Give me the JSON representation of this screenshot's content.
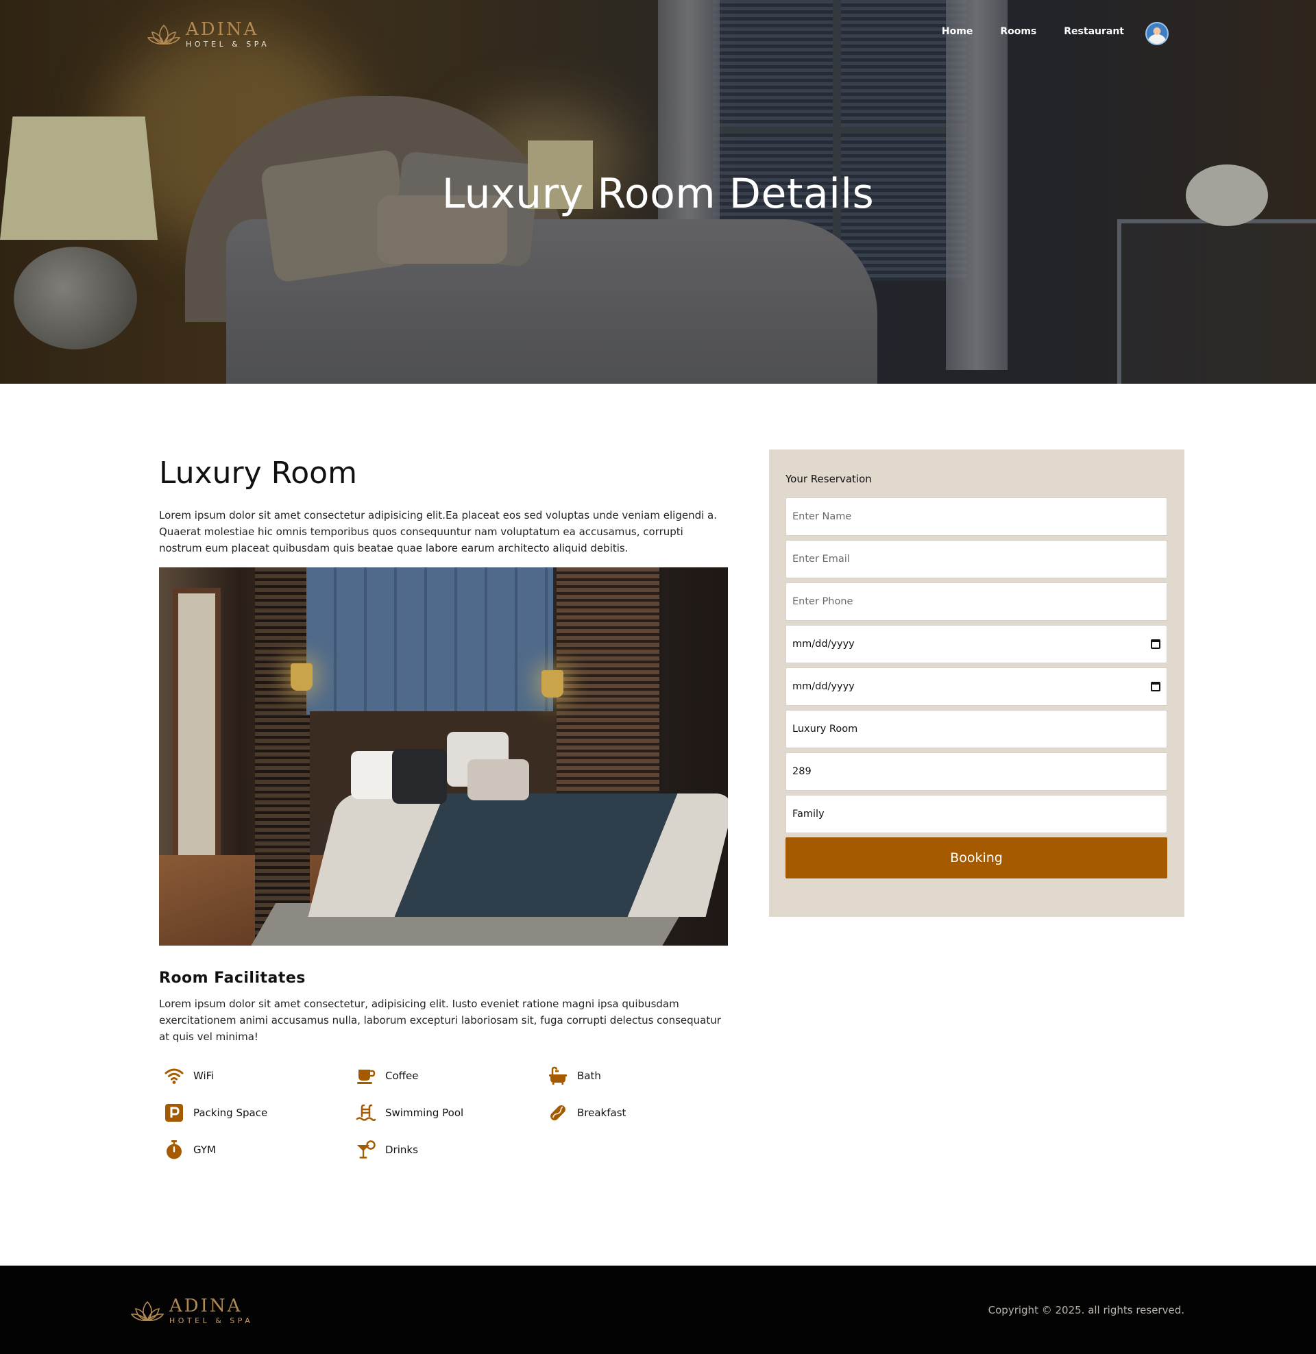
{
  "brand": {
    "name": "ADINA",
    "tagline": "HOTEL & SPA",
    "color": "#b38a52"
  },
  "nav": {
    "items": [
      {
        "label": "Home"
      },
      {
        "label": "Rooms"
      },
      {
        "label": "Restaurant"
      }
    ],
    "avatar_icon": "user-avatar"
  },
  "hero": {
    "title": "Luxury Room Details"
  },
  "room": {
    "title": "Luxury Room",
    "description": "Lorem ipsum dolor sit amet consectetur adipisicing elit.Ea placeat eos sed voluptas unde veniam eligendi a. Quaerat molestiae hic omnis temporibus quos consequuntur nam voluptatum ea accusamus, corrupti nostrum eum placeat quibusdam quis beatae quae labore earum architecto aliquid debitis."
  },
  "facilities": {
    "title": "Room Facilitates",
    "description": "Lorem ipsum dolor sit amet consectetur, adipisicing elit. Iusto eveniet ratione magni ipsa quibusdam exercitationem animi accusamus nulla, laborum excepturi laboriosam sit, fuga corrupti delectus consequatur at quis vel minima!",
    "icon_color": "#a55a00",
    "items": [
      {
        "label": "WiFi",
        "icon": "wifi-icon"
      },
      {
        "label": "Coffee",
        "icon": "coffee-icon"
      },
      {
        "label": "Bath",
        "icon": "bath-icon"
      },
      {
        "label": "Packing Space",
        "icon": "parking-icon"
      },
      {
        "label": "Swimming Pool",
        "icon": "swimming-pool-icon"
      },
      {
        "label": "Breakfast",
        "icon": "breakfast-icon"
      },
      {
        "label": "GYM",
        "icon": "stopwatch-icon"
      },
      {
        "label": "Drinks",
        "icon": "cocktail-icon"
      }
    ]
  },
  "reservation": {
    "title": "Your Reservation",
    "name_placeholder": "Enter Name",
    "email_placeholder": "Enter Email",
    "phone_placeholder": "Enter Phone",
    "checkin_value": "mm/dd/yyyy",
    "checkout_value": "mm/dd/yyyy",
    "room_value": "Luxury Room",
    "price_value": "289",
    "type_value": "Family",
    "submit_label": "Booking",
    "button_color": "#a55a00",
    "panel_color": "#e1d8ce"
  },
  "footer": {
    "copyright": "Copyright © 2025. all rights reserved."
  }
}
